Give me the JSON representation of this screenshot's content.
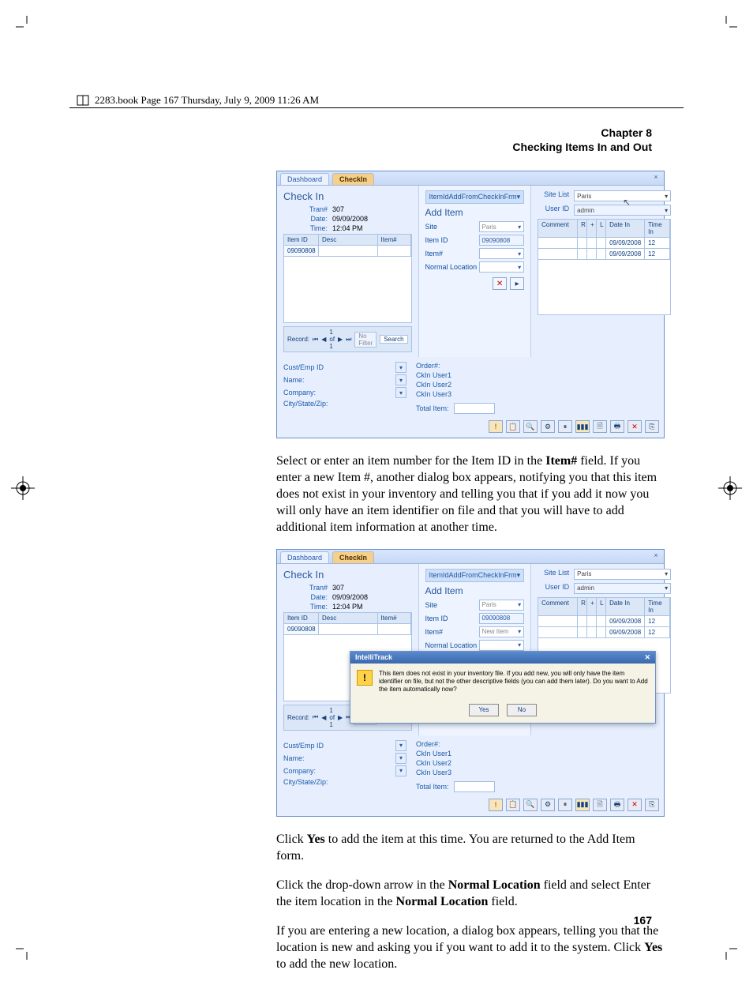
{
  "header": {
    "crop_text": "2283.book  Page 167  Thursday, July 9, 2009  11:26 AM"
  },
  "chapter": {
    "line1": "Chapter 8",
    "line2": "Checking Items In and Out"
  },
  "screenshot1": {
    "tabs": {
      "dashboard": "Dashboard",
      "checkin": "CheckIn"
    },
    "checkin_title": "Check In",
    "tran_label": "Tran#",
    "tran_value": "307",
    "date_label": "Date:",
    "date_value": "09/09/2008",
    "time_label": "Time:",
    "time_value": "12:04 PM",
    "grid": {
      "col1": "Item ID",
      "col2": "Desc",
      "col3": "Item#",
      "row1_c1": "09090808"
    },
    "pager": {
      "record": "Record: ",
      "pos": "1 of 1",
      "nofilter": "No Filter",
      "search": "Search"
    },
    "mid": {
      "frm_title": "ItemIdAddFromCheckInFrm",
      "header": "Add Item",
      "site_label": "Site",
      "site_value": "Paris",
      "itemid_label": "Item ID",
      "itemid_value": "09090808",
      "itemnum_label": "Item#",
      "itemnum_value": "",
      "normloc_label": "Normal Location",
      "btn_cancel": "✕",
      "btn_save": "▸"
    },
    "right": {
      "sitelist_label": "Site List",
      "sitelist_value": "Paris",
      "userid_label": "User ID",
      "userid_value": "admin",
      "cols": {
        "comment": "Comment",
        "r": "R",
        "plus": "+",
        "l": "L",
        "datein": "Date In",
        "timein": "Time In"
      },
      "row1_date": "09/09/2008",
      "row1_time": "12",
      "row2_date": "09/09/2008",
      "row2_time": "12"
    },
    "below": {
      "custemp": "Cust/Emp ID",
      "name": "Name:",
      "company": "Company:",
      "csz": "City/State/Zip:",
      "order": "Order#:",
      "u1": "CkIn User1",
      "u2": "CkIn User2",
      "u3": "CkIn User3",
      "total": "Total Item:"
    }
  },
  "paragraph1": {
    "p1a": "Select or enter an item number for the Item ID in the ",
    "p1b": "Item#",
    "p1c": " field. If you enter a new Item #, another dialog box appears, notifying you that this item does not exist in your inventory and telling you that if you add it now you will only have an item identifier on file and that you will have to add additional item information at another time."
  },
  "screenshot2": {
    "mid_itemnum_value": "New Item",
    "dlg": {
      "title": "IntelliTrack",
      "text": "This item does not exist in your inventory file. If you add new, you will only have the item identifier on file, but not the other descriptive fields (you can add them later). Do you want to Add the item automatically now?",
      "yes": "Yes",
      "no": "No"
    }
  },
  "paragraph2": {
    "a": "Click ",
    "b": "Yes",
    "c": " to add the item at this time. You are returned to the Add Item form."
  },
  "paragraph3": {
    "a": "Click the drop-down arrow in the ",
    "b": "Normal Location",
    "c": " field and select Enter the item location in the ",
    "d": "Normal Location",
    "e": " field."
  },
  "paragraph4": {
    "a": "If you are entering a new location, a dialog box appears, telling you that the location is new and asking you if you want to add it to the system. Click ",
    "b": "Yes",
    "c": " to add the new location."
  },
  "page_number": "167"
}
